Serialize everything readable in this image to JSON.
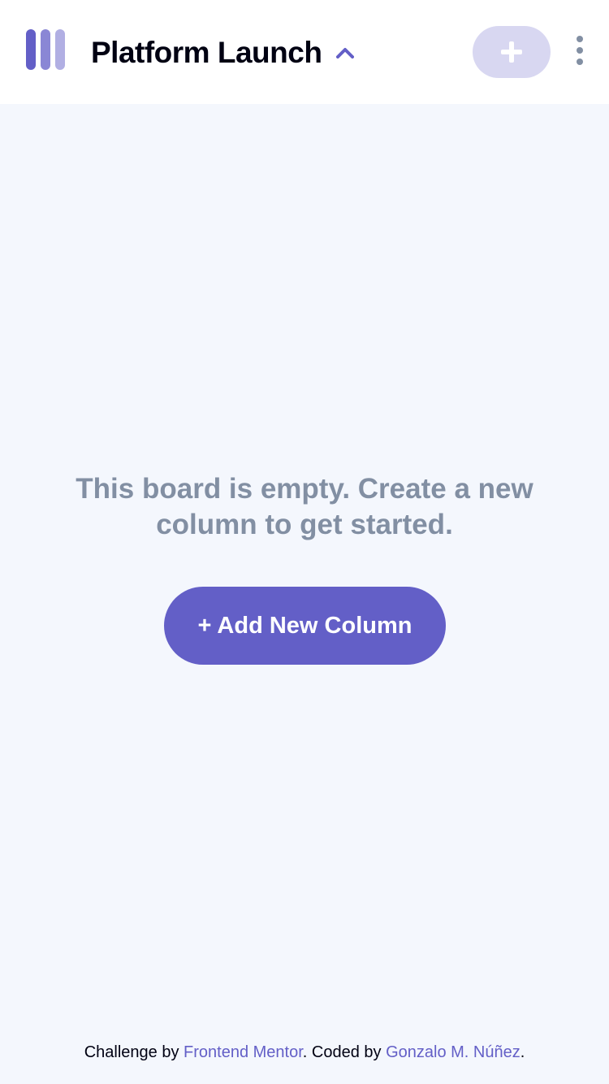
{
  "header": {
    "board_title": "Platform Launch",
    "add_task_label": "+",
    "logo_icon": "kanban-logo-icon",
    "chevron_icon": "chevron-up-icon",
    "menu_icon": "vertical-ellipsis-icon"
  },
  "main": {
    "empty_message": "This board is empty. Create a new column to get started.",
    "add_column_label": "+ Add New Column"
  },
  "footer": {
    "challenge_prefix": "Challenge by",
    "challenge_link": "Frontend Mentor",
    "coded_prefix": ". Coded by",
    "author_link": "Gonzalo M. Núñez",
    "suffix": "."
  },
  "colors": {
    "accent": "#635FC7",
    "accent_light": "#D8D7F1",
    "background": "#F4F7FD",
    "muted_text": "#828FA3",
    "dark_text": "#000112"
  }
}
